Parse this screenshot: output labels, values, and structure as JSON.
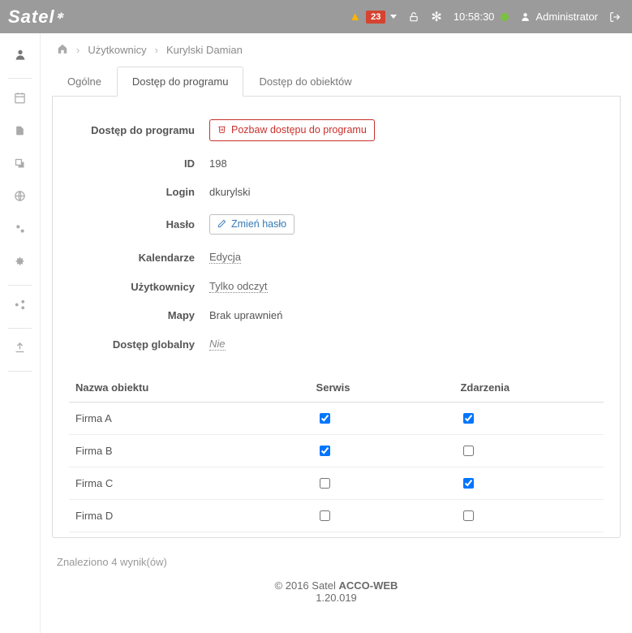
{
  "header": {
    "logo": "Satel",
    "alert_count": "23",
    "time": "10:58:30",
    "user_label": "Administrator"
  },
  "breadcrumb": {
    "level1": "Użytkownicy",
    "level2": "Kurylski Damian"
  },
  "tabs": {
    "general": "Ogólne",
    "program_access": "Dostęp do programu",
    "object_access": "Dostęp do obiektów"
  },
  "form": {
    "program_access_label": "Dostęp do programu",
    "revoke_button": "Pozbaw dostępu do programu",
    "id_label": "ID",
    "id_value": "198",
    "login_label": "Login",
    "login_value": "dkurylski",
    "password_label": "Hasło",
    "change_password_button": "Zmień hasło",
    "calendars_label": "Kalendarze",
    "calendars_value": "Edycja",
    "users_label": "Użytkownicy",
    "users_value": "Tylko odczyt",
    "maps_label": "Mapy",
    "maps_value": "Brak uprawnień",
    "global_access_label": "Dostęp globalny",
    "global_access_value": "Nie"
  },
  "table": {
    "col_object": "Nazwa obiektu",
    "col_service": "Serwis",
    "col_events": "Zdarzenia",
    "rows": [
      {
        "name": "Firma A",
        "service": true,
        "events": true
      },
      {
        "name": "Firma B",
        "service": true,
        "events": false
      },
      {
        "name": "Firma C",
        "service": false,
        "events": true
      },
      {
        "name": "Firma D",
        "service": false,
        "events": false
      }
    ]
  },
  "result_count": "Znaleziono 4 wynik(ów)",
  "footer": {
    "line1_prefix": "© 2016 Satel ",
    "line1_bold": "ACCO-WEB",
    "version": "1.20.019"
  }
}
